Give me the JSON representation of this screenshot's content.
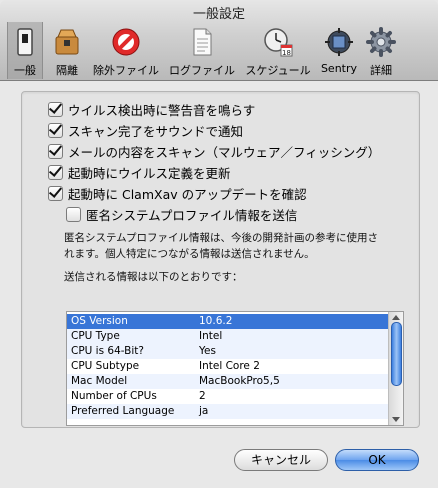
{
  "window": {
    "title": "一般設定"
  },
  "toolbar": {
    "items": [
      {
        "label": "一般",
        "icon": "switch-icon",
        "selected": true
      },
      {
        "label": "隔離",
        "icon": "quarantine-box-icon"
      },
      {
        "label": "除外ファイル",
        "icon": "no-entry-icon"
      },
      {
        "label": "ログファイル",
        "icon": "document-icon"
      },
      {
        "label": "スケジュール",
        "icon": "clock-calendar-icon"
      },
      {
        "label": "Sentry",
        "icon": "sentry-monitor-icon"
      },
      {
        "label": "詳細",
        "icon": "gear-icon"
      }
    ]
  },
  "options": {
    "alert_sound": {
      "label": "ウイルス検出時に警告音を鳴らす",
      "checked": true
    },
    "scan_notify": {
      "label": "スキャン完了をサウンドで通知",
      "checked": true
    },
    "mail_scan": {
      "label": "メールの内容をスキャン（マルウェア／フィッシング）",
      "checked": true
    },
    "update_defs": {
      "label": "起動時にウイルス定義を更新",
      "checked": true
    },
    "check_updates": {
      "label": "起動時に ClamXav のアップデートを確認",
      "checked": true
    },
    "anon_profile": {
      "label": "匿名システムプロファイル情報を送信",
      "checked": false
    }
  },
  "notes": {
    "line1": "匿名システムプロファイル情報は、今後の開発計画の参考に使用さ",
    "line2": "れます。個人特定につながる情報は送信されません。",
    "sent_info": "送信される情報は以下のとおりです："
  },
  "profile_table": {
    "rows": [
      {
        "key": "OS Version",
        "value": "10.6.2"
      },
      {
        "key": "CPU Type",
        "value": "Intel"
      },
      {
        "key": "CPU is 64-Bit?",
        "value": "Yes"
      },
      {
        "key": "CPU Subtype",
        "value": "Intel Core 2"
      },
      {
        "key": "Mac Model",
        "value": "MacBookPro5,5"
      },
      {
        "key": "Number of CPUs",
        "value": "2"
      },
      {
        "key": "Preferred Language",
        "value": "ja"
      }
    ],
    "selected_index": 0
  },
  "buttons": {
    "cancel": "キャンセル",
    "ok": "OK"
  }
}
